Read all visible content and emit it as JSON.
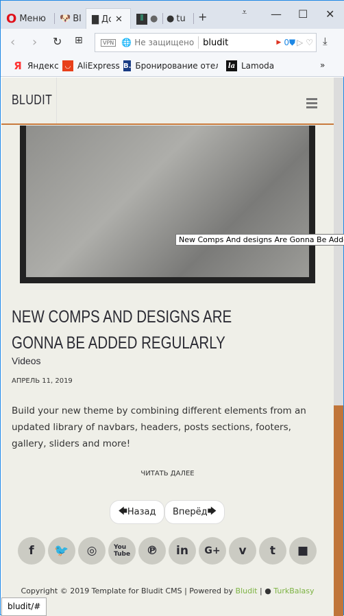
{
  "browser": {
    "tabs": [
      {
        "label": "Меню"
      },
      {
        "label": "Bl"
      },
      {
        "label": "До"
      },
      {
        "label": ""
      },
      {
        "label": "tu"
      }
    ],
    "vpn": "VPN",
    "security": "Не защищено",
    "url": "bludit",
    "badge_count": "0",
    "bookmarks": [
      {
        "label": "Яндекс"
      },
      {
        "label": "AliExpress"
      },
      {
        "label": "Бронирование отеле"
      },
      {
        "label": "Lamoda"
      }
    ],
    "more": "»"
  },
  "site": {
    "logo": "BLUDIT"
  },
  "post": {
    "image_tooltip": "New Comps And designs Are Gonna Be Added",
    "title": "NEW COMPS AND DESIGNS ARE GONNA BE ADDED REGULARLY",
    "category": "Videos",
    "date": "АПРЕЛЬ 11, 2019",
    "body": "Build your new theme by combining different elements from an updated library of navbars, headers, posts sections, footers, gallery, sliders and more!",
    "read_more": "ЧИТАТЬ ДАЛЕЕ"
  },
  "pager": {
    "prev": "Назад",
    "next": "Вперёд"
  },
  "social": [
    "facebook",
    "twitter",
    "instagram",
    "youtube",
    "pinterest",
    "linkedin",
    "google-plus",
    "vimeo",
    "tumblr",
    "flickr"
  ],
  "footer": {
    "text": "Copyright © 2019 Template for Bludit CMS | Powered by",
    "bludit": "Bludit",
    "sep": "|",
    "author": "TurkBalasy"
  },
  "status_url": "bludit/#",
  "colors": {
    "accent": "#c0753a",
    "link": "#7cb342",
    "bg": "#efefe8"
  }
}
